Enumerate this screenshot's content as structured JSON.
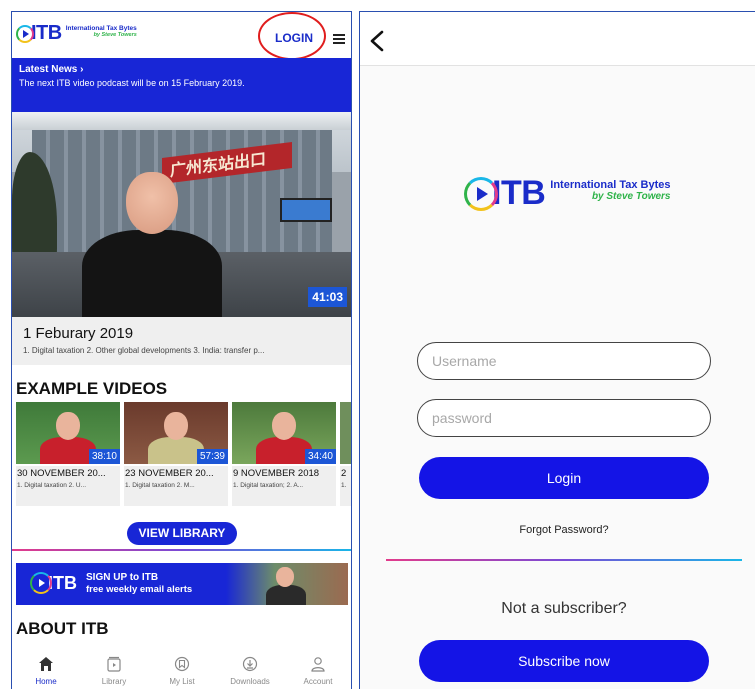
{
  "brand": {
    "logo_text": "ITB",
    "tagline_top": "International Tax Bytes",
    "tagline_bottom": "by Steve Towers",
    "colors": {
      "primary": "#1826d6",
      "accent_red": "#e01d1d",
      "green": "#2fb34a"
    }
  },
  "left": {
    "header": {
      "login_label": "LOGIN",
      "menu_icon": "hamburger-icon"
    },
    "news": {
      "heading": "Latest News ›",
      "text": "The next ITB video podcast will be on 15 February 2019."
    },
    "featured": {
      "duration": "41:03",
      "title": "1 Feburary 2019",
      "description": "1. Digital taxation 2. Other global developments 3. India: transfer p..."
    },
    "example_section_title": "EXAMPLE VIDEOS",
    "videos": [
      {
        "duration": "38:10",
        "title": "30 NOVEMBER 20...",
        "description": "1. Digital taxation 2. U..."
      },
      {
        "duration": "57:39",
        "title": "23 NOVEMBER 20...",
        "description": "1. Digital taxation 2. M..."
      },
      {
        "duration": "34:40",
        "title": "9 NOVEMBER 2018",
        "description": "1. Digital taxation; 2. A..."
      },
      {
        "duration": "",
        "title": "2",
        "description": "1."
      }
    ],
    "view_library_label": "VIEW LIBRARY",
    "banner": {
      "logo_text": "ITB",
      "line1": "SIGN UP to ITB",
      "line2": "free weekly email alerts"
    },
    "about_title": "ABOUT ITB",
    "tabs": [
      {
        "label": "Home",
        "icon": "home-icon",
        "active": true
      },
      {
        "label": "Library",
        "icon": "library-icon",
        "active": false
      },
      {
        "label": "My List",
        "icon": "my-list-icon",
        "active": false
      },
      {
        "label": "Downloads",
        "icon": "downloads-icon",
        "active": false
      },
      {
        "label": "Account",
        "icon": "account-icon",
        "active": false
      }
    ]
  },
  "right": {
    "back_icon": "chevron-left-icon",
    "username_placeholder": "Username",
    "password_placeholder": "password",
    "login_button": "Login",
    "forgot_password": "Forgot Password?",
    "not_subscriber": "Not a subscriber?",
    "subscribe_button": "Subscribe now"
  }
}
